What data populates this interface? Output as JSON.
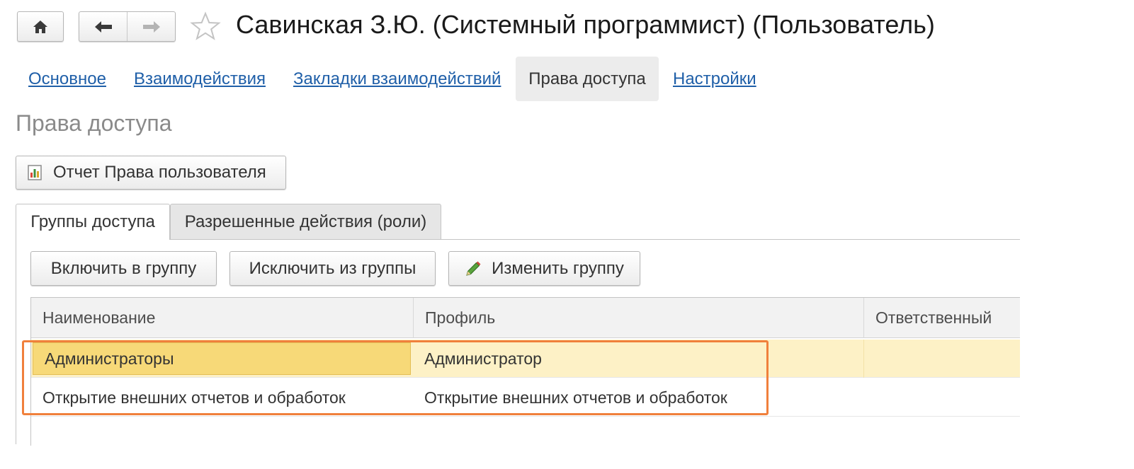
{
  "window": {
    "title": "Савинская З.Ю. (Системный программист) (Пользователь)"
  },
  "nav_tabs": [
    {
      "label": "Основное"
    },
    {
      "label": "Взаимодействия"
    },
    {
      "label": "Закладки взаимодействий"
    },
    {
      "label": "Права доступа"
    },
    {
      "label": "Настройки"
    }
  ],
  "active_nav_tab": "Права доступа",
  "section_title": "Права доступа",
  "report_button": {
    "label": "Отчет Права пользователя",
    "icon": "report-chart-icon"
  },
  "inner_tabs": [
    {
      "label": "Группы доступа"
    },
    {
      "label": "Разрешенные действия (роли)"
    }
  ],
  "active_inner_tab": "Группы доступа",
  "toolbar": {
    "include_label": "Включить в группу",
    "exclude_label": "Исключить из группы",
    "change_label": "Изменить группу",
    "change_icon": "pencil-icon"
  },
  "table": {
    "columns": [
      "Наименование",
      "Профиль",
      "Ответственный"
    ],
    "rows": [
      {
        "name": "Администраторы",
        "profile": "Администратор",
        "responsible": ""
      },
      {
        "name": "Открытие внешних отчетов и обработок",
        "profile": "Открытие внешних отчетов и обработок",
        "responsible": ""
      }
    ]
  },
  "colors": {
    "link": "#1f5fa8",
    "selected_row": "#fdf1c6",
    "focused_cell": "#f7d978",
    "highlight_frame": "#f0803c"
  }
}
